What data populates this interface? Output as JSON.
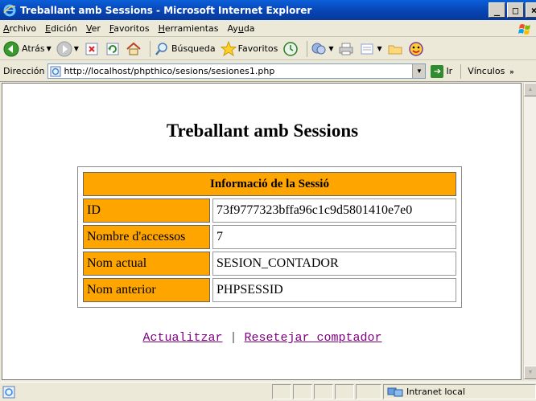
{
  "window": {
    "title": "Treballant amb Sessions - Microsoft Internet Explorer",
    "minimize": "_",
    "maximize": "□",
    "close": "×"
  },
  "menu": [
    "Archivo",
    "Edición",
    "Ver",
    "Favoritos",
    "Herramientas",
    "Ayuda"
  ],
  "menu_mnemonics": [
    "A",
    "E",
    "V",
    "F",
    "H",
    "u"
  ],
  "toolbar": {
    "back_label": "Atrás",
    "search_label": "Búsqueda",
    "favorites_label": "Favoritos"
  },
  "address": {
    "label": "Dirección",
    "url": "http://localhost/phpthico/sesions/sesiones1.php",
    "go_label": "Ir",
    "links_label": "Vínculos"
  },
  "page": {
    "title": "Treballant amb Sessions",
    "table_header": "Informació de la Sessió",
    "rows": [
      {
        "label": "ID",
        "value": "73f9777323bffa96c1c9d5801410e7e0"
      },
      {
        "label": "Nombre d'accessos",
        "value": "7"
      },
      {
        "label": "Nom actual",
        "value": "SESION_CONTADOR"
      },
      {
        "label": "Nom anterior",
        "value": "PHPSESSID"
      }
    ],
    "link_refresh": "Actualitzar",
    "link_separator": "|",
    "link_reset": "Resetejar comptador"
  },
  "status": {
    "zone": "Intranet local"
  },
  "colors": {
    "label_bg": "#ffa500",
    "link_visited": "#800080",
    "title_bar": "#0842b0"
  }
}
